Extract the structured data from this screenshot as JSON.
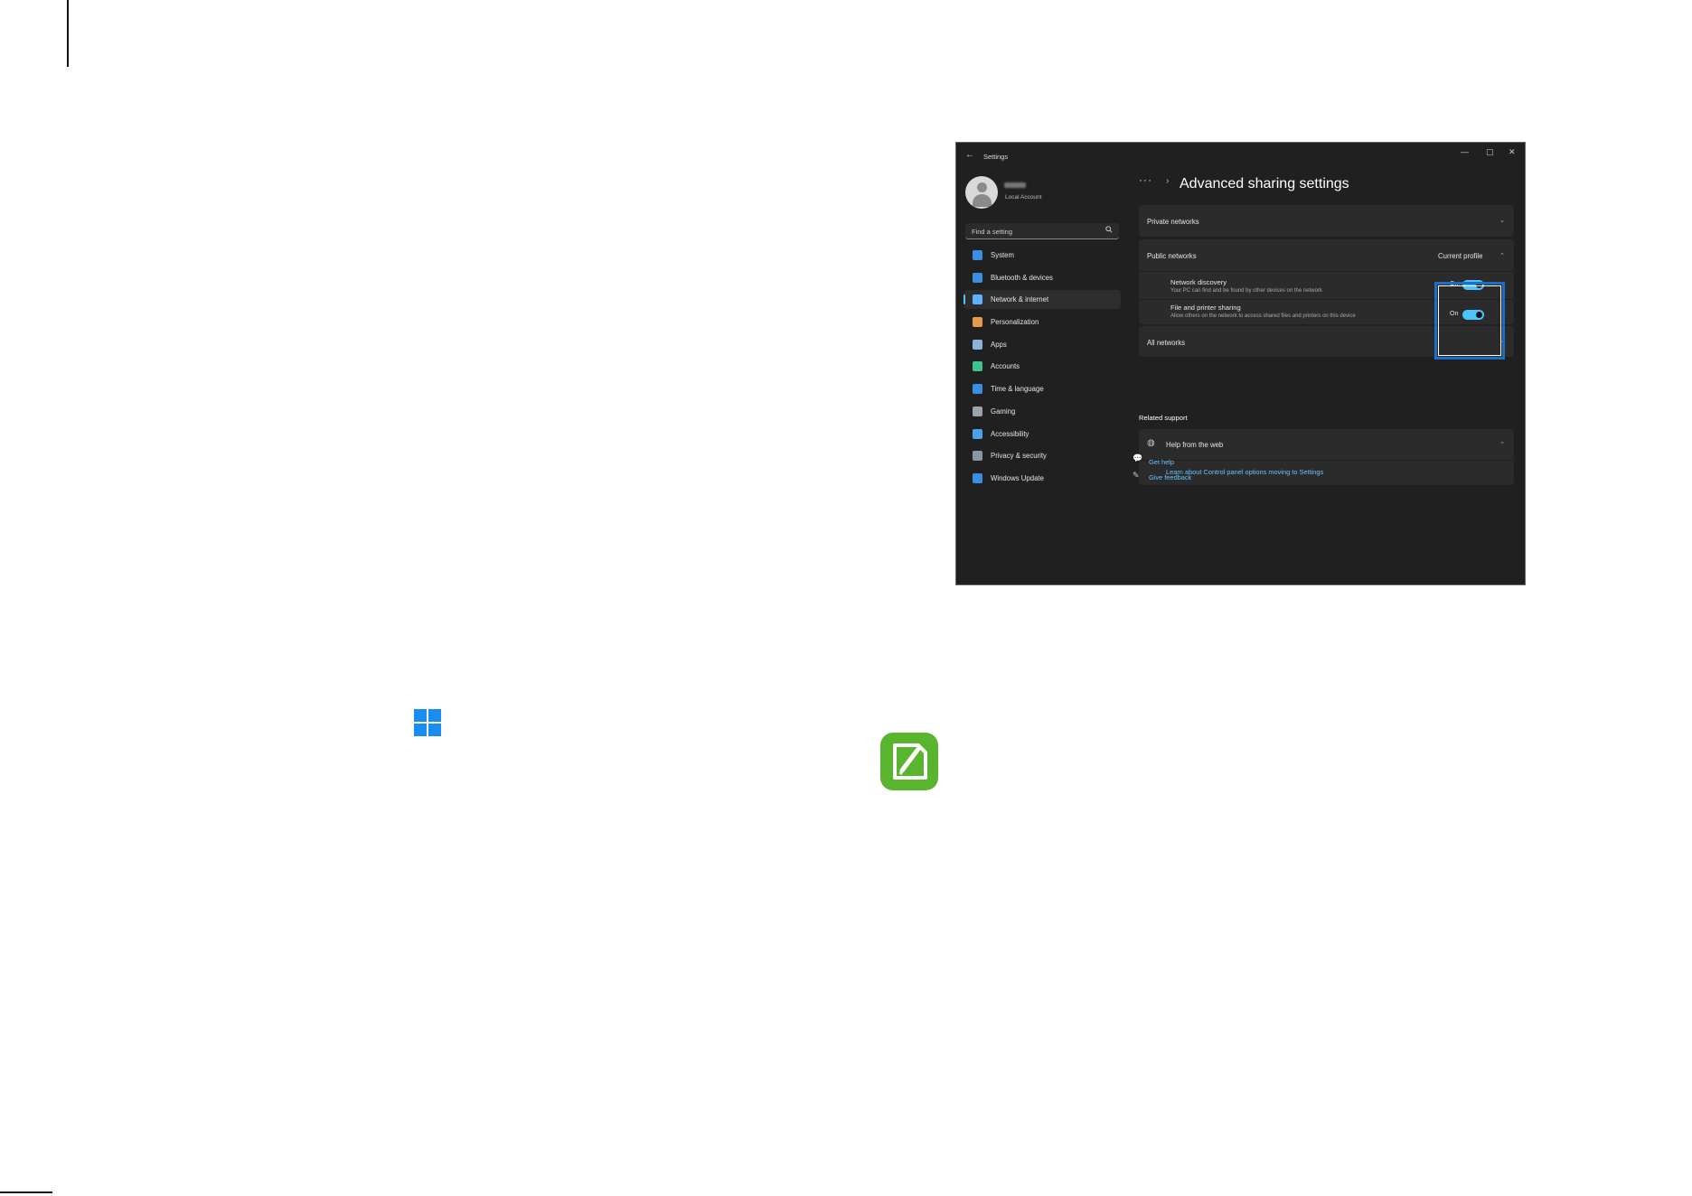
{
  "settings": {
    "title": "Settings",
    "account_type": "Local Account",
    "search_placeholder": "Find a setting",
    "nav": [
      {
        "label": "System",
        "icon": "monitor-icon",
        "color": "#3b8fe0"
      },
      {
        "label": "Bluetooth & devices",
        "icon": "bluetooth-icon",
        "color": "#3b8fe0"
      },
      {
        "label": "Network & internet",
        "icon": "wifi-icon",
        "color": "#5fb0ff",
        "active": true
      },
      {
        "label": "Personalization",
        "icon": "brush-icon",
        "color": "#e39a4c"
      },
      {
        "label": "Apps",
        "icon": "apps-icon",
        "color": "#8ab4d8"
      },
      {
        "label": "Accounts",
        "icon": "person-icon",
        "color": "#3ec28f"
      },
      {
        "label": "Time & language",
        "icon": "globe-clock-icon",
        "color": "#3b8fe0"
      },
      {
        "label": "Gaming",
        "icon": "gamepad-icon",
        "color": "#9aa4ad"
      },
      {
        "label": "Accessibility",
        "icon": "accessibility-icon",
        "color": "#4aa3e8"
      },
      {
        "label": "Privacy & security",
        "icon": "shield-icon",
        "color": "#8a96a3"
      },
      {
        "label": "Windows Update",
        "icon": "update-icon",
        "color": "#3b8fe0"
      }
    ],
    "breadcrumb_dots": "···",
    "breadcrumb_sep": "›",
    "page_title": "Advanced sharing settings",
    "private_networks": "Private networks",
    "public_networks": "Public networks",
    "current_profile": "Current profile",
    "network_discovery": {
      "label": "Network discovery",
      "desc": "Your PC can find and be found by other devices on the network",
      "state": "On"
    },
    "file_sharing": {
      "label": "File and printer sharing",
      "desc": "Allow others on the network to access shared files and printers on this device",
      "state": "On"
    },
    "all_networks": "All networks",
    "related_support": "Related support",
    "help_from_web": "Help from the web",
    "learn_link": "Learn about Control panel options moving to Settings",
    "get_help": "Get help",
    "give_feedback": "Give feedback"
  },
  "colors": {
    "accent": "#4cc2ff",
    "highlight": "#1a6fc4",
    "note_icon": "#59b52d",
    "windows_logo": "#1a8cf0"
  }
}
